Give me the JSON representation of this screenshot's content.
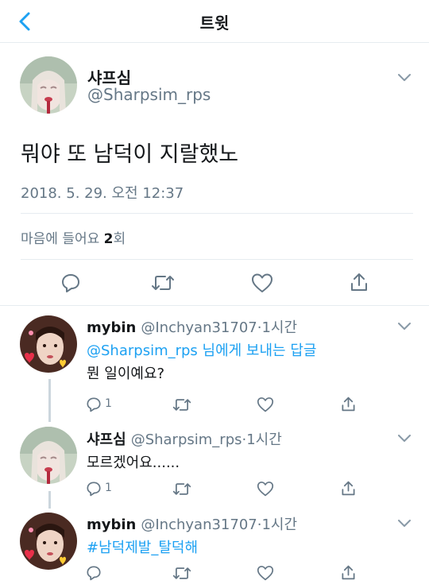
{
  "header": {
    "title": "트윗",
    "back_icon": "back-arrow-icon"
  },
  "colors": {
    "accent": "#1da1f2",
    "secondary_text": "#657786",
    "divider": "#e6ecf0"
  },
  "main_tweet": {
    "name": "샤프심",
    "handle": "@Sharpsim_rps",
    "text": "뭐야 또 남덕이 지랄했노",
    "date": "2018. 5. 29. 오전 12:37",
    "likes_prefix": "마음에 들어요 ",
    "likes_count": "2",
    "likes_suffix": "회"
  },
  "replies": [
    {
      "name": "mybin",
      "handle": "@Inchyan31707",
      "time": "·1시간",
      "mention": "@Sharpsim_rps",
      "reply_to_suffix": " 님에게 보내는 답글",
      "text": "뭔 일이예요?",
      "reply_count": "1"
    },
    {
      "name": "샤프심",
      "handle": "@Sharpsim_rps",
      "time": "·1시간",
      "text": "모르겠어요......",
      "reply_count": "1"
    },
    {
      "name": "mybin",
      "handle": "@Inchyan31707",
      "time": "·1시간",
      "hashtag": "#남덕제발_탈덕해"
    }
  ]
}
